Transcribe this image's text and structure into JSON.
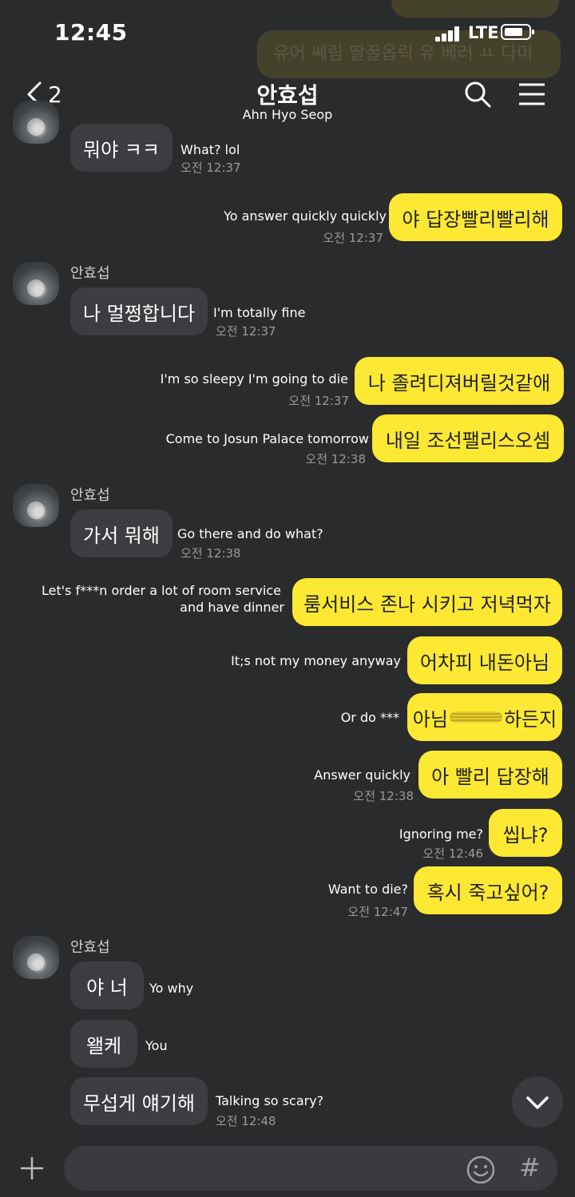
{
  "status": {
    "time": "12:45",
    "network": "LTE"
  },
  "header": {
    "back_count": "2",
    "title": "안효섭",
    "subtitle": "Ahn Hyo Seop"
  },
  "background_hint": "유어 쎄림 딸꿀옵릭 유 베러 ㅛ 다미",
  "messages": [
    {
      "dir": "recv",
      "text": "뭐야 ㅋㅋ",
      "translation": "What? lol",
      "time": "오전 12:37"
    },
    {
      "dir": "sent",
      "text": "야 답장빨리빨리해",
      "translation": "Yo answer quickly quickly",
      "time": "오전 12:37"
    },
    {
      "dir": "recv",
      "sender": "안효섭",
      "text": "나 멀쩡합니다",
      "translation": "I'm totally fine",
      "time": "오전 12:37"
    },
    {
      "dir": "sent",
      "text": "나 졸려디져버릴것같애",
      "translation": "I'm so sleepy I'm going to die",
      "time": "오전 12:37"
    },
    {
      "dir": "sent",
      "text": "내일 조선팰리스오셈",
      "translation": "Come to Josun Palace tomorrow",
      "time": "오전 12:38"
    },
    {
      "dir": "recv",
      "sender": "안효섭",
      "text": "가서 뭐해",
      "translation": "Go there and do what?",
      "time": "오전 12:38"
    },
    {
      "dir": "sent",
      "text": "룸서비스 존나 시키고 저녁먹자",
      "translation_line1": "Let's f***n order a lot of room service",
      "translation_line2": "and have dinner"
    },
    {
      "dir": "sent",
      "text": "어차피 내돈아님",
      "translation": "It;s not my money anyway"
    },
    {
      "dir": "sent",
      "text_before": "아님",
      "text_after": "하든지",
      "translation": "Or do ***"
    },
    {
      "dir": "sent",
      "text": "아 빨리 답장해",
      "translation": "Answer quickly",
      "time": "오전 12:38"
    },
    {
      "dir": "sent",
      "text": "씹냐?",
      "translation": "Ignoring me?",
      "time": "오전 12:46"
    },
    {
      "dir": "sent",
      "text": "혹시 죽고싶어?",
      "translation": "Want to die?",
      "time": "오전 12:47"
    },
    {
      "dir": "recv",
      "sender": "안효섭",
      "text": "야 너",
      "translation": "Yo why"
    },
    {
      "dir": "recv",
      "text": "왤케",
      "translation": "You"
    },
    {
      "dir": "recv",
      "text": "무섭게 얘기해",
      "translation": "Talking so scary?",
      "time": "오전 12:48"
    }
  ],
  "icons": [
    "back-chevron-icon",
    "search-icon",
    "menu-icon",
    "chevron-down-icon",
    "plus-icon",
    "emoji-icon",
    "hash-icon"
  ],
  "colors": {
    "background": "#2a2b2d",
    "sent_bubble": "#fde834",
    "received_bubble": "#3c3d40"
  }
}
